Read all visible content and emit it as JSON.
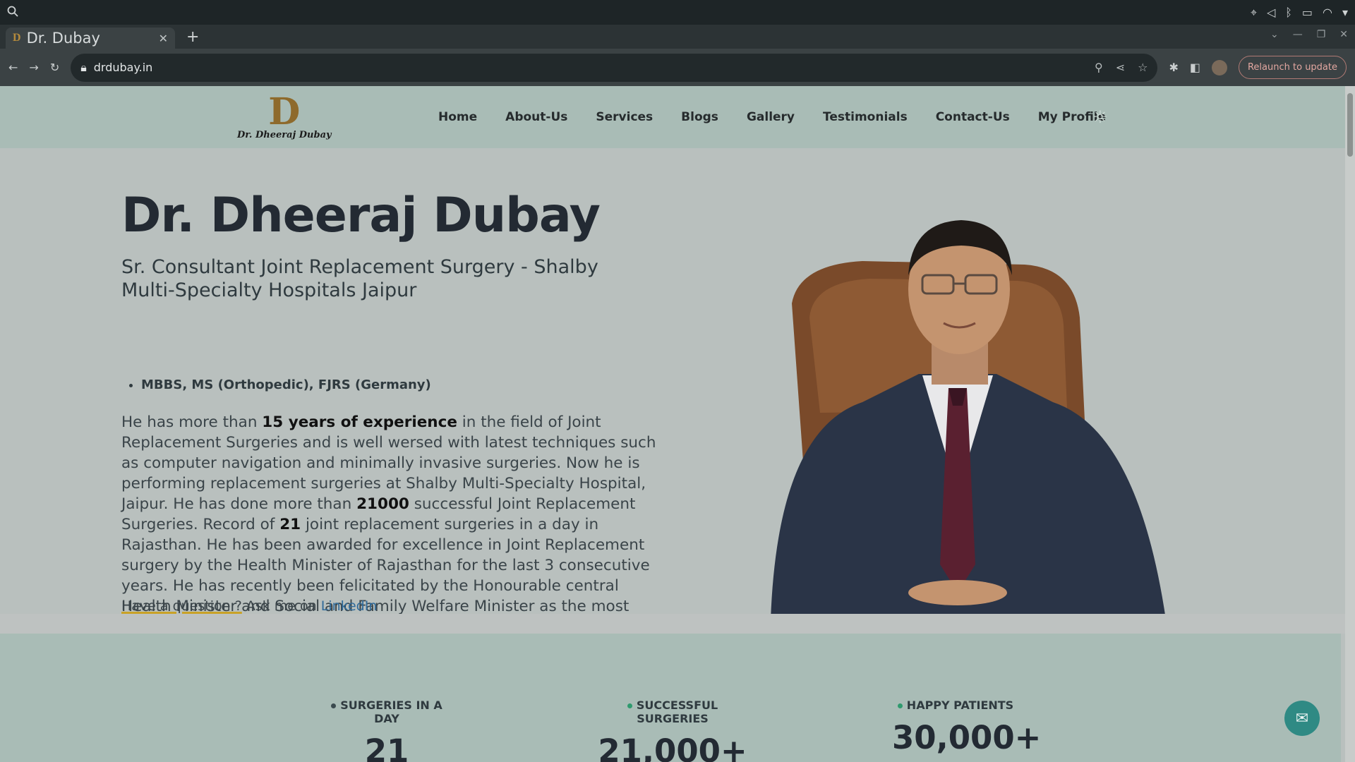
{
  "browser": {
    "tab_title": "Dr. Dubay",
    "tab_favicon": "D",
    "url": "drdubay.in",
    "relaunch_label": "Relaunch to update"
  },
  "site": {
    "logo_mark": "D",
    "logo_text": "Dr. Dheeraj Dubay",
    "nav": [
      "Home",
      "About-Us",
      "Services",
      "Blogs",
      "Gallery",
      "Testimonials",
      "Contact-Us",
      "My Profile"
    ]
  },
  "hero": {
    "name": "Dr. Dheeraj Dubay",
    "role": "Sr. Consultant Joint Replacement Surgery - Shalby Multi-Specialty Hospitals Jaipur",
    "qualification": "MBBS, MS (Orthopedic), FJRS (Germany)",
    "bio_1": "He has more than ",
    "bio_experience": "15 years of experience",
    "bio_2": " in the field of Joint Replacement Surgeries and is well wersed with latest techniques such as computer navigation and minimally invasive surgeries. Now he is performing replacement surgeries at Shalby Multi-Specialty Hospital, Jaipur. He has done more than ",
    "bio_count": "21000",
    "bio_3": " successful Joint Replacement Surgeries. Record of ",
    "bio_record": "21",
    "bio_4": " joint replacement surgeries in a day in Rajasthan. He has been awarded for excellence in Joint Replacement surgery by the Health Minister of Rajasthan for the last 3 consecutive years. He has recently been felicitated by the Honourable central Health Minister and Social and Family Welfare Minister as the most trusted Joint Replacement Surgeon of North India.",
    "question": "Have a question ?",
    "ask": " Ask me on ",
    "linkedin": "LinkedIn"
  },
  "stats": [
    {
      "label": "SURGERIES IN A DAY",
      "value": "21",
      "dot_color": "#3b4a4f"
    },
    {
      "label": "SUCCESSFUL SURGERIES",
      "value": "21,000+",
      "dot_color": "#2f9a6e"
    },
    {
      "label": "HAPPY PATIENTS",
      "value": "30,000+",
      "dot_color": "#2f9a6e"
    }
  ]
}
